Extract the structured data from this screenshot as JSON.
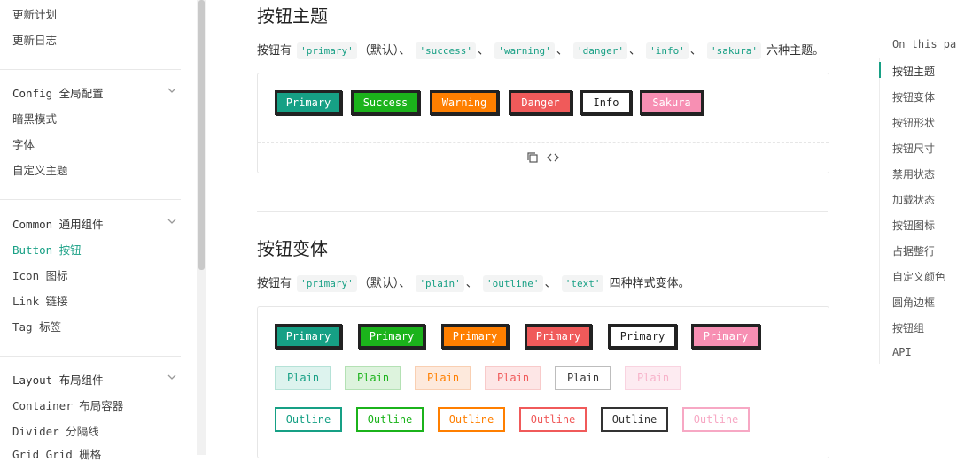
{
  "sidebar": {
    "top_items": [
      "更新计划",
      "更新日志"
    ],
    "groups": [
      {
        "title": "Config 全局配置",
        "items": [
          "暗黑模式",
          "字体",
          "自定义主题"
        ]
      },
      {
        "title": "Common 通用组件",
        "items": [
          "Button 按钮",
          "Icon 图标",
          "Link 链接",
          "Tag 标签"
        ]
      },
      {
        "title": "Layout 布局组件",
        "items": [
          "Container 布局容器",
          "Divider 分隔线",
          "Grid Grid 栅格"
        ]
      }
    ],
    "active_item": "Button 按钮"
  },
  "section1": {
    "title": "按钮主题",
    "desc_prefix": "按钮有",
    "desc_codes": [
      "'primary'",
      "'success'",
      "'warning'",
      "'danger'",
      "'info'",
      "'sakura'"
    ],
    "desc_default": "（默认）",
    "sep": "、",
    "desc_suffix": "六种主题。",
    "buttons": [
      "Primary",
      "Success",
      "Warning",
      "Danger",
      "Info",
      "Sakura"
    ]
  },
  "section2": {
    "title": "按钮变体",
    "desc_prefix": "按钮有",
    "desc_codes": [
      "'primary'",
      "'plain'",
      "'outline'",
      "'text'"
    ],
    "desc_default": "（默认）",
    "sep": "、",
    "desc_suffix": "四种样式变体。",
    "row1": [
      "Primary",
      "Primary",
      "Primary",
      "Primary",
      "Primary",
      "Primary"
    ],
    "row2": [
      "Plain",
      "Plain",
      "Plain",
      "Plain",
      "Plain",
      "Plain"
    ],
    "row3": [
      "Outline",
      "Outline",
      "Outline",
      "Outline",
      "Outline",
      "Outline"
    ]
  },
  "demo_toolbar": {
    "copy_icon": "copy-icon",
    "code_icon": "code-icon"
  },
  "toc": {
    "heading": "On this page",
    "items": [
      "按钮主题",
      "按钮变体",
      "按钮形状",
      "按钮尺寸",
      "禁用状态",
      "加载状态",
      "按钮图标",
      "占据整行",
      "自定义颜色",
      "圆角边框",
      "按钮组",
      "API"
    ],
    "active": "按钮主题"
  },
  "colors": {
    "primary": "#16a085",
    "success": "#1bb31b",
    "warning": "#ff7f00",
    "danger": "#f05a5a",
    "info": "#ffffff",
    "sakura": "#f78fb3",
    "accent": "#18a085"
  }
}
